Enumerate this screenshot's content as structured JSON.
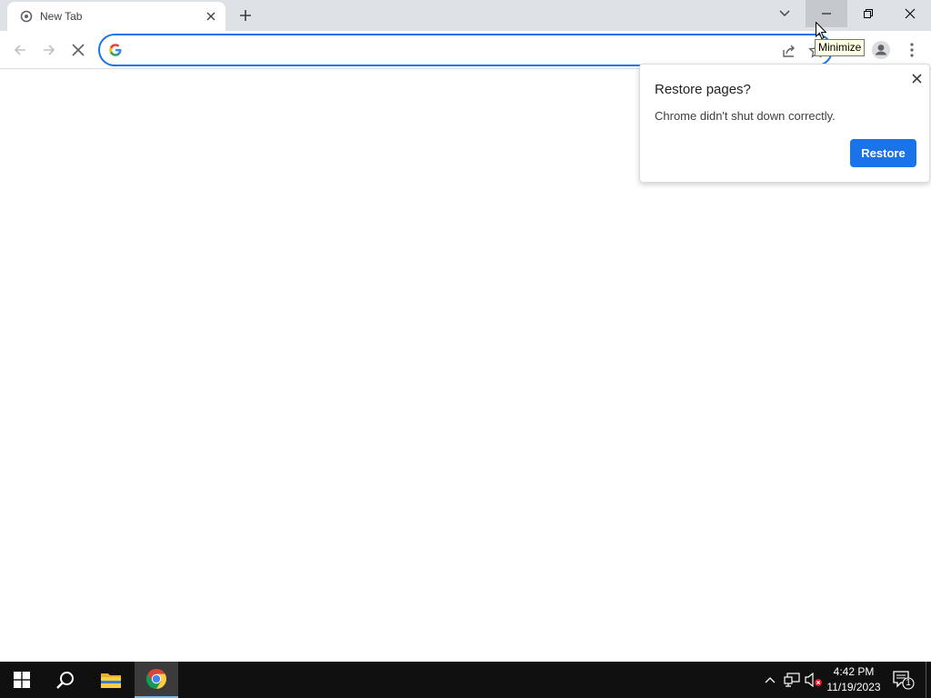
{
  "browser": {
    "tab": {
      "title": "New Tab"
    },
    "omnibox": {
      "value": "",
      "placeholder": ""
    },
    "tooltip": "Minimize"
  },
  "restore_bubble": {
    "title": "Restore pages?",
    "message": "Chrome didn't shut down correctly.",
    "button_label": "Restore"
  },
  "taskbar": {
    "clock_time": "4:42 PM",
    "clock_date": "11/19/2023",
    "notification_count": "1"
  },
  "colors": {
    "accent": "#1a73e8",
    "tabstrip": "#dee1e6",
    "taskbar": "#101010"
  }
}
